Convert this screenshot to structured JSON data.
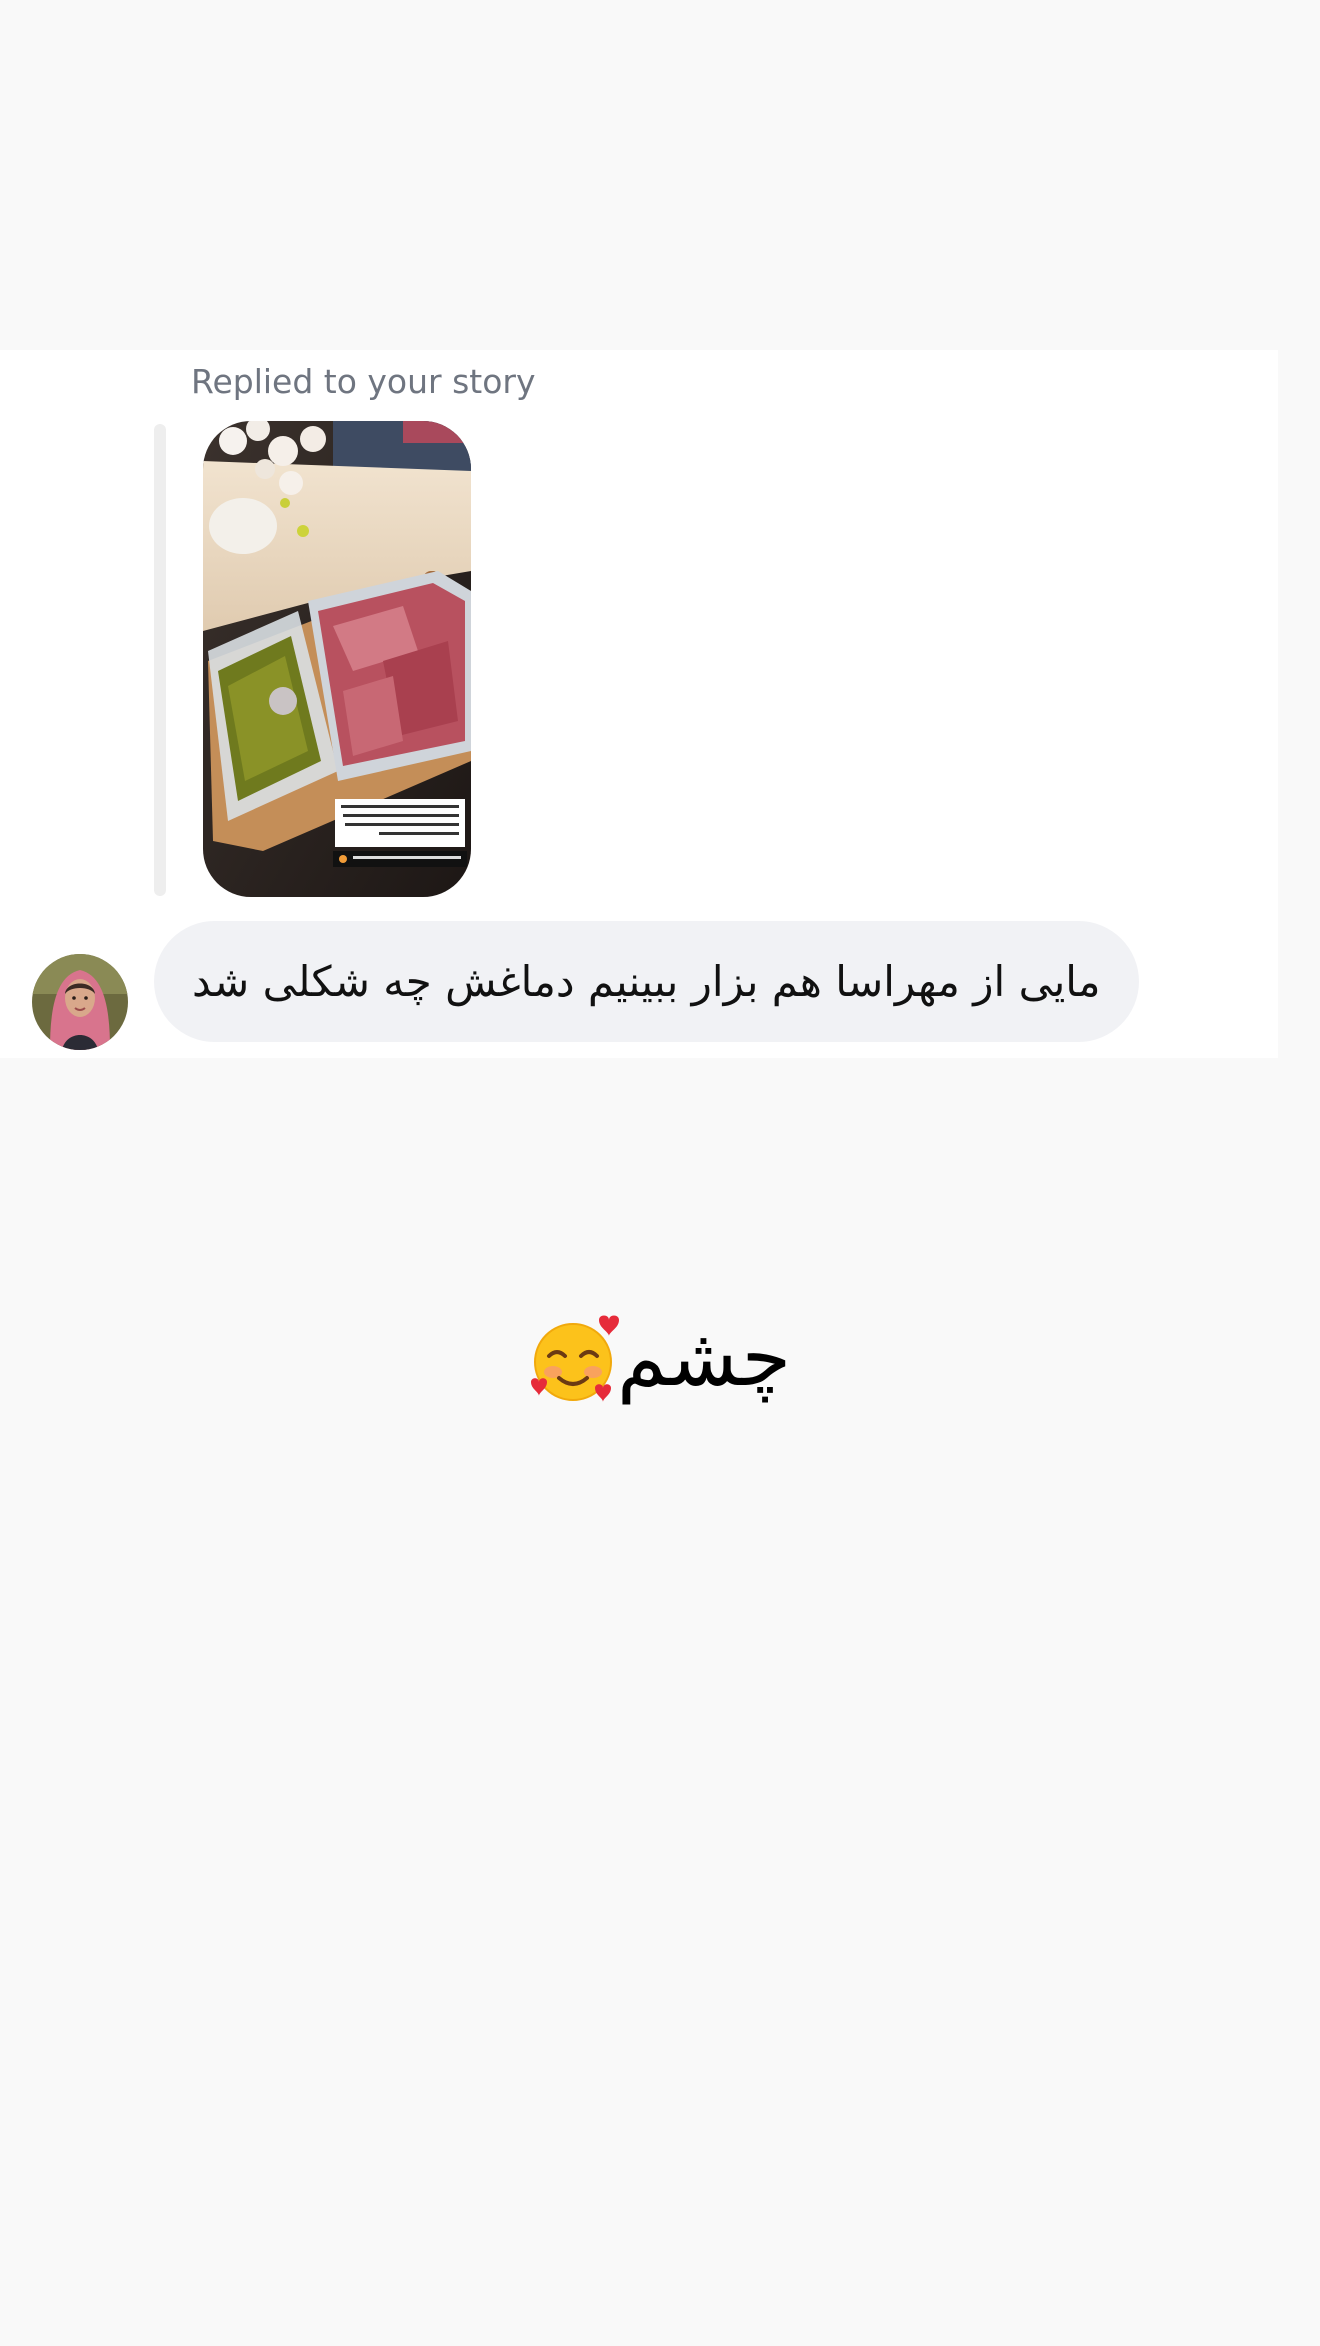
{
  "conversation": {
    "reply_context": "Replied to your story",
    "story_preview": {
      "overlay_lines": [
        "مامان اینا دارن میان و میخوام واسه",
        "فردا ناهار قرمه سبزی بار بذارم، چون",
        "من و مامان گاهی کار داریم فردا و گفتم",
        "از الان ناهار فردا رو بذارم"
      ],
      "caption": "واسه شیم مامانم گفتن پخته میدارم"
    },
    "received_message": "مایی از مهراسا هم بزار ببینیم دماغش چه شکلی شد",
    "sent_message": {
      "text": "چشم",
      "emoji": "smiling-face-with-hearts"
    }
  },
  "colors": {
    "page_background": "#f9f9f9",
    "panel_background": "#ffffff",
    "bubble_background": "#f1f2f5",
    "reply_label": "#6f7580"
  }
}
